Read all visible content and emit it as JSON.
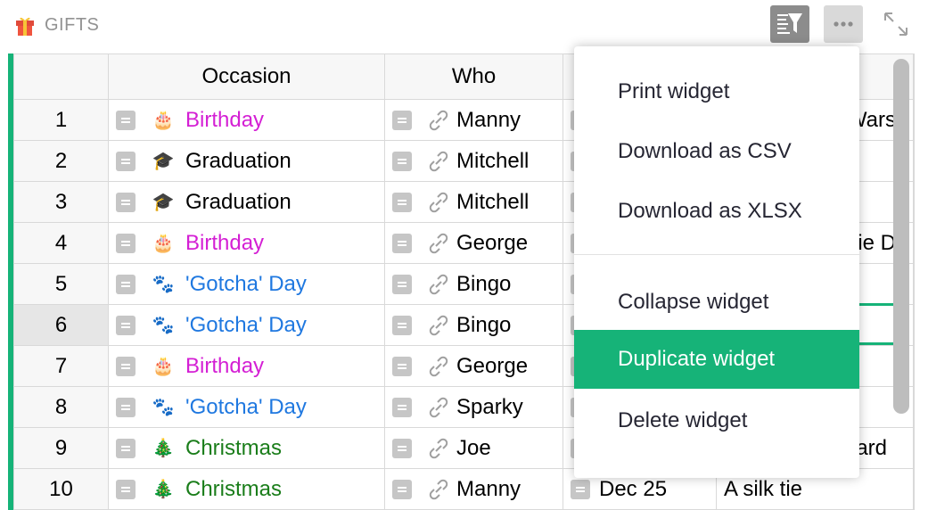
{
  "header": {
    "title": "GIFTS",
    "icon": "gift-icon",
    "filter_icon": "sort-filter-icon",
    "more_icon": "more-dots-icon",
    "expand_icon": "expand-icon"
  },
  "columns": [
    "",
    "Occasion",
    "Who"
  ],
  "rows": [
    {
      "num": "1",
      "occasion": "Birthday",
      "occasion_icon": "cake-icon",
      "occasion_color": "#d41fd4",
      "who": "Manny",
      "extra": "Wars"
    },
    {
      "num": "2",
      "occasion": "Graduation",
      "occasion_icon": "grad-cap-icon",
      "occasion_color": "#000000",
      "who": "Mitchell",
      "extra": ""
    },
    {
      "num": "3",
      "occasion": "Graduation",
      "occasion_icon": "grad-cap-icon",
      "occasion_color": "#000000",
      "who": "Mitchell",
      "extra": ""
    },
    {
      "num": "4",
      "occasion": "Birthday",
      "occasion_icon": "cake-icon",
      "occasion_color": "#d41fd4",
      "who": "George",
      "extra": "ie D"
    },
    {
      "num": "5",
      "occasion": "'Gotcha' Day",
      "occasion_icon": "paw-icon",
      "occasion_color": "#1f78e0",
      "who": "Bingo",
      "extra": ""
    },
    {
      "num": "6",
      "occasion": "'Gotcha' Day",
      "occasion_icon": "paw-icon",
      "occasion_color": "#1f78e0",
      "who": "Bingo",
      "extra": ""
    },
    {
      "num": "7",
      "occasion": "Birthday",
      "occasion_icon": "cake-icon",
      "occasion_color": "#d41fd4",
      "who": "George",
      "extra": ""
    },
    {
      "num": "8",
      "occasion": "'Gotcha' Day",
      "occasion_icon": "paw-icon",
      "occasion_color": "#1f78e0",
      "who": "Sparky",
      "extra": ""
    },
    {
      "num": "9",
      "occasion": "Christmas",
      "occasion_icon": "tree-icon",
      "occasion_color": "#1a7d1a",
      "who": "Joe",
      "extra": "ard"
    },
    {
      "num": "10",
      "occasion": "Christmas",
      "occasion_icon": "tree-icon",
      "occasion_color": "#1a7d1a",
      "who": "Manny",
      "date": "Dec 25",
      "extra": "A silk tie"
    }
  ],
  "menu": {
    "items": [
      {
        "label": "Print widget"
      },
      {
        "label": "Download as CSV"
      },
      {
        "label": "Download as XLSX"
      },
      {
        "label": "Collapse widget"
      },
      {
        "label": "Duplicate widget",
        "selected": true
      },
      {
        "label": "Delete widget"
      }
    ]
  },
  "colors": {
    "accent": "#16b378",
    "birthday": "#d41fd4",
    "gotcha": "#1f78e0",
    "christmas": "#1a7d1a"
  }
}
